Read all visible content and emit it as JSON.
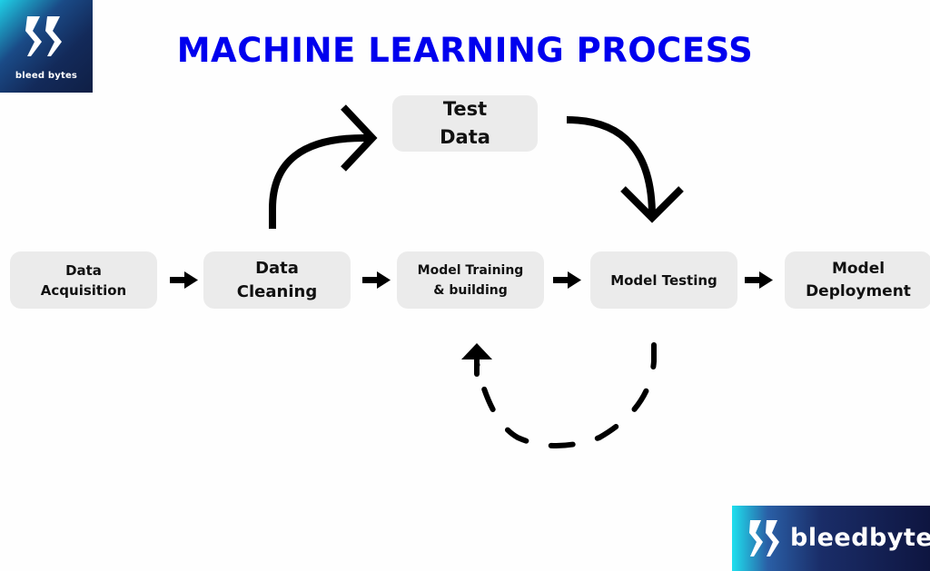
{
  "title": "MACHINE LEARNING PROCESS",
  "colors": {
    "title": "#0000ee",
    "box_fill": "#ebebeb",
    "arrow": "#000000",
    "logo_gradient_start": "#1fd0e6",
    "logo_gradient_end": "#0f1f45"
  },
  "logos": {
    "top_left": {
      "icon": "bleedbytes-logo-mark-icon",
      "text": "bleed bytes"
    },
    "bottom_right": {
      "icon": "bleedbytes-logo-mark-icon",
      "text": "bleedbytes"
    }
  },
  "steps": [
    {
      "id": "data-acquisition",
      "lines": [
        "Data",
        "Acquisition"
      ]
    },
    {
      "id": "data-cleaning",
      "lines": [
        "Data",
        "Cleaning"
      ]
    },
    {
      "id": "model-training",
      "lines": [
        "Model Training",
        "& building"
      ]
    },
    {
      "id": "model-testing",
      "lines": [
        "Model Testing"
      ]
    },
    {
      "id": "model-deployment",
      "lines": [
        "Model",
        "Deployment"
      ]
    }
  ],
  "test_data": {
    "lines": [
      "Test",
      "Data"
    ]
  },
  "connectors": [
    {
      "from": "data-acquisition",
      "to": "data-cleaning",
      "style": "solid-arrow"
    },
    {
      "from": "data-cleaning",
      "to": "model-training",
      "style": "solid-arrow"
    },
    {
      "from": "model-training",
      "to": "model-testing",
      "style": "solid-arrow"
    },
    {
      "from": "model-testing",
      "to": "model-deployment",
      "style": "solid-arrow"
    },
    {
      "from": "data-cleaning",
      "to": "test-data",
      "style": "curved-arrow"
    },
    {
      "from": "test-data",
      "to": "model-testing",
      "style": "curved-arrow"
    },
    {
      "from": "model-testing",
      "to": "model-training",
      "style": "dashed-curved-arrow"
    }
  ]
}
